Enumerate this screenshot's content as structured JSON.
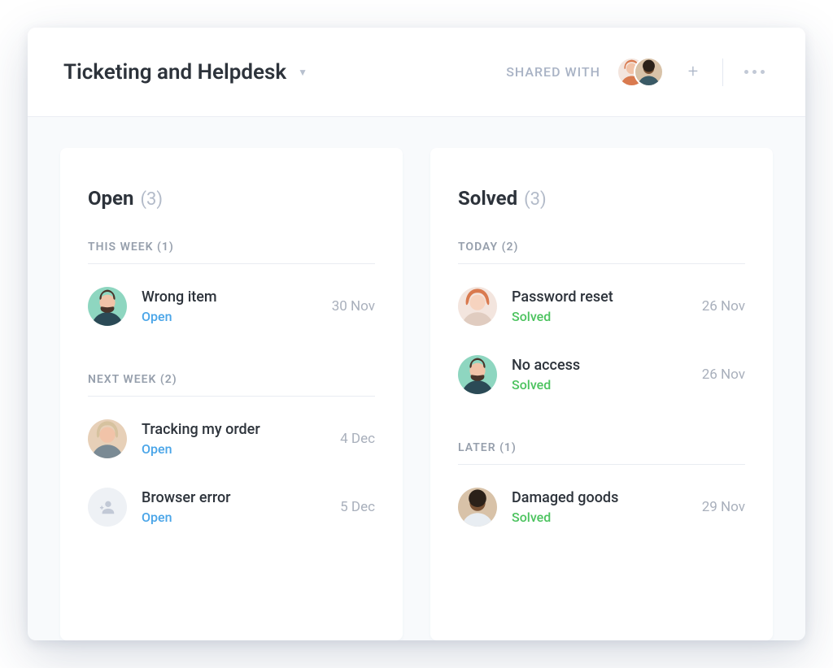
{
  "header": {
    "title": "Ticketing and Helpdesk",
    "shared_label": "SHARED WITH"
  },
  "columns": [
    {
      "title": "Open",
      "count": "(3)",
      "sections": [
        {
          "label": "THIS WEEK (1)",
          "tickets": [
            {
              "title": "Wrong item",
              "status": "Open",
              "status_class": "open",
              "date": "30 Nov",
              "avatar": "face-1"
            }
          ]
        },
        {
          "label": "NEXT WEEK (2)",
          "tickets": [
            {
              "title": "Tracking my order",
              "status": "Open",
              "status_class": "open",
              "date": "4 Dec",
              "avatar": "face-2"
            },
            {
              "title": "Browser error",
              "status": "Open",
              "status_class": "open",
              "date": "5 Dec",
              "avatar": "face-empty"
            }
          ]
        }
      ]
    },
    {
      "title": "Solved",
      "count": "(3)",
      "sections": [
        {
          "label": "TODAY (2)",
          "tickets": [
            {
              "title": "Password reset",
              "status": "Solved",
              "status_class": "solved",
              "date": "26 Nov",
              "avatar": "face-3"
            },
            {
              "title": "No access",
              "status": "Solved",
              "status_class": "solved",
              "date": "26 Nov",
              "avatar": "face-1"
            }
          ]
        },
        {
          "label": "LATER (1)",
          "tickets": [
            {
              "title": "Damaged goods",
              "status": "Solved",
              "status_class": "solved",
              "date": "29 Nov",
              "avatar": "face-4"
            }
          ]
        }
      ]
    }
  ]
}
